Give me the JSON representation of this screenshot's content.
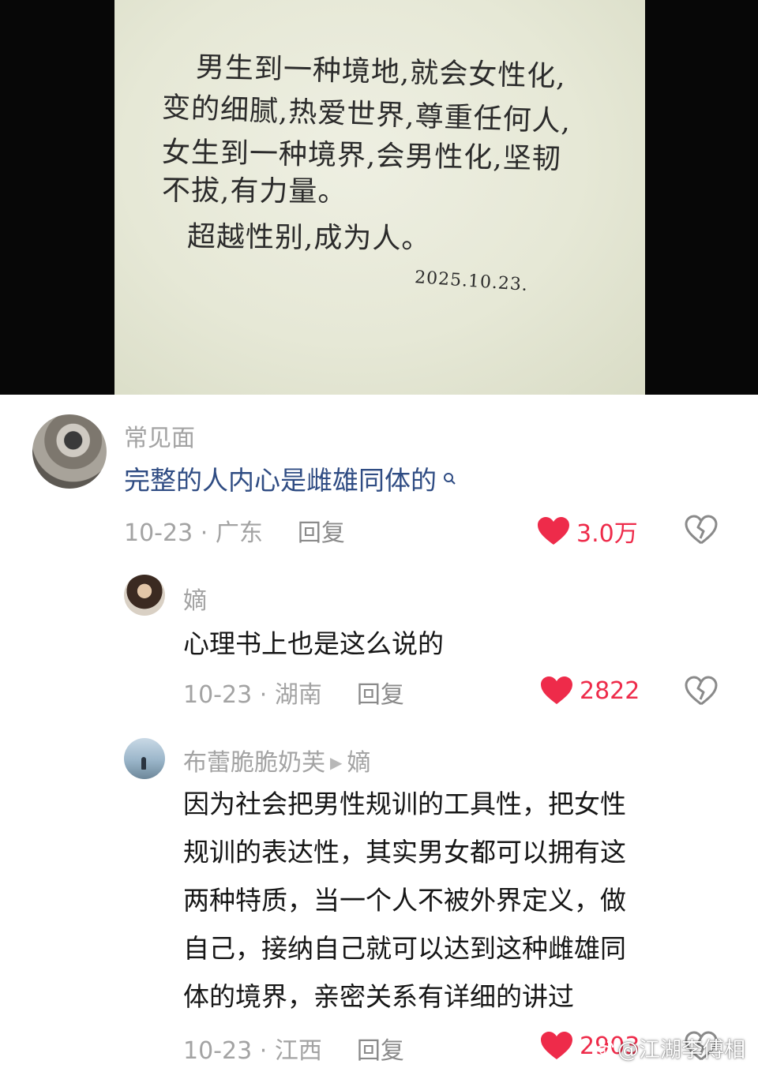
{
  "note": {
    "lines": [
      "男生到一种境地,就会女性化,",
      "变的细腻,热爱世界,尊重任何人,",
      "女生到一种境界,会男性化,坚韧",
      "不拔,有力量。",
      "超越性别,成为人。"
    ],
    "date": "2025.10.23."
  },
  "comments": [
    {
      "user": "常见面",
      "text": "完整的人内心是雌雄同体的",
      "text_link_icon": "search-icon",
      "date": "10-23",
      "location": "广东",
      "reply_label": "回复",
      "likes": "3.0万"
    },
    {
      "user": "嫡",
      "text": "心理书上也是这么说的",
      "date": "10-23",
      "location": "湖南",
      "reply_label": "回复",
      "likes": "2822"
    },
    {
      "user": "布蕾脆脆奶芙",
      "reply_to": "嫡",
      "text_lines": [
        "因为社会把男性规训的工具性，把女性",
        "规训的表达性，其实男女都可以拥有这",
        "两种特质，当一个人不被外界定义，做",
        "自己，接纳自己就可以达到这种雌雄同",
        "体的境界，亲密关系有详细的讲过"
      ],
      "date": "10-23",
      "location": "江西",
      "reply_label": "回复",
      "likes": "2903"
    }
  ],
  "separator": "·",
  "watermark": "@江湖李傅相",
  "colors": {
    "like": "#ee2b4a",
    "mention": "#2f4c83",
    "meta": "#a3a3a3"
  }
}
